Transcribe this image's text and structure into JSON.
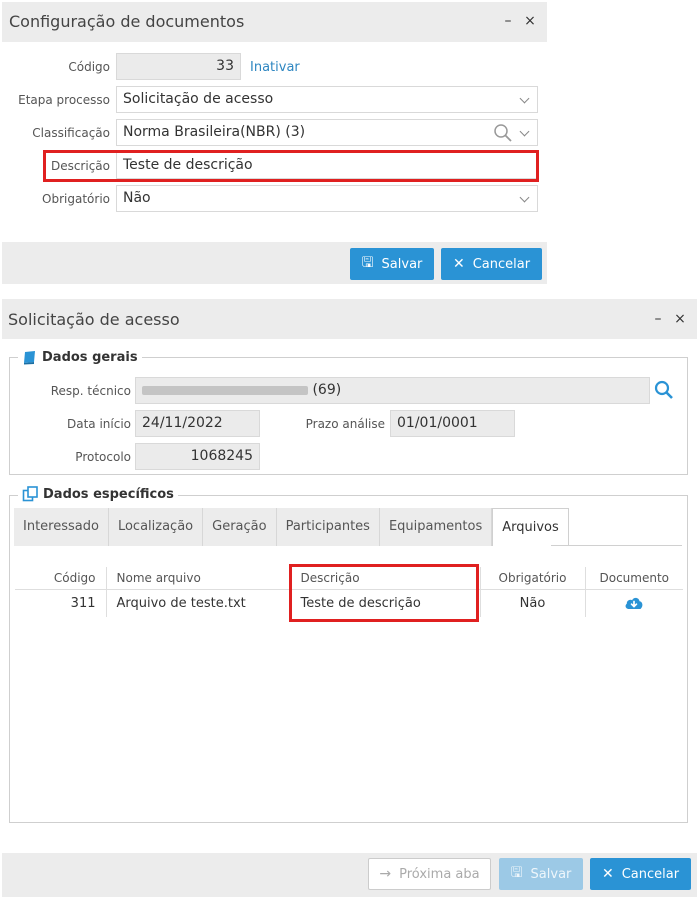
{
  "config_panel": {
    "title": "Configuração de documentos",
    "minimize": "–",
    "close": "×",
    "labels": {
      "codigo": "Código",
      "etapa": "Etapa processo",
      "classificacao": "Classificação",
      "descricao": "Descrição",
      "obrigatorio": "Obrigatório"
    },
    "values": {
      "codigo": "33",
      "etapa": "Solicitação de acesso",
      "classificacao": "Norma Brasileira(NBR) (3)",
      "descricao": "Teste de descrição",
      "obrigatorio": "Não"
    },
    "inativar": "Inativar",
    "save_label": "Salvar",
    "cancel_label": "Cancelar"
  },
  "request_panel": {
    "title": "Solicitação de acesso",
    "minimize": "–",
    "close": "×",
    "general": {
      "legend": "Dados gerais",
      "labels": {
        "resp": "Resp. técnico",
        "data_inicio": "Data início",
        "prazo": "Prazo análise",
        "protocolo": "Protocolo"
      },
      "values": {
        "resp_suffix": "(69)",
        "data_inicio": "24/11/2022",
        "prazo": "01/01/0001",
        "protocolo": "1068245"
      }
    },
    "specific": {
      "legend": "Dados específicos",
      "tabs": [
        "Interessado",
        "Localização",
        "Geração",
        "Participantes",
        "Equipamentos",
        "Arquivos"
      ],
      "columns": [
        "Código",
        "Nome arquivo",
        "Descrição",
        "Obrigatório",
        "Documento"
      ],
      "rows": [
        {
          "codigo": "311",
          "nome": "Arquivo de teste.txt",
          "descricao": "Teste de descrição",
          "obrigatorio": "Não"
        }
      ]
    },
    "next_tab_label": "Próxima aba",
    "save_label": "Salvar",
    "cancel_label": "Cancelar"
  },
  "colors": {
    "accent": "#2a93d5",
    "highlight": "#e02020",
    "header_bg": "#ececec"
  }
}
